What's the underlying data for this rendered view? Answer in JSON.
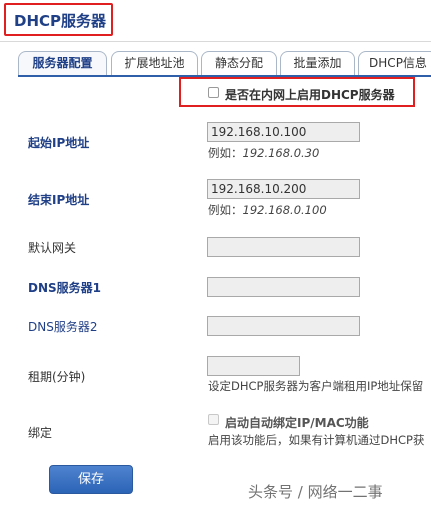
{
  "header": {
    "title": "DHCP服务器"
  },
  "tabs": [
    {
      "label": "服务器配置",
      "active": true
    },
    {
      "label": "扩展地址池"
    },
    {
      "label": "静态分配"
    },
    {
      "label": "批量添加"
    },
    {
      "label": "DHCP信息"
    }
  ],
  "enable": {
    "label": "是否在内网上启用DHCP服务器",
    "checked": false
  },
  "form": {
    "start_ip": {
      "label": "起始IP地址",
      "value": "192.168.10.100",
      "hint_prefix": "例如：",
      "hint_example": "192.168.0.30"
    },
    "end_ip": {
      "label": "结束IP地址",
      "value": "192.168.10.200",
      "hint_prefix": "例如：",
      "hint_example": "192.168.0.100"
    },
    "gateway": {
      "label": "默认网关",
      "value": ""
    },
    "dns1": {
      "label": "DNS服务器1",
      "value": ""
    },
    "dns2": {
      "label": "DNS服务器2",
      "value": ""
    },
    "lease": {
      "label": "租期(分钟)",
      "value": "",
      "desc": "设定DHCP服务器为客户端租用IP地址保留"
    },
    "bind": {
      "label": "绑定",
      "checkbox_label": "启动自动绑定IP/MAC功能",
      "desc": "启用该功能后，如果有计算机通过DHCP获"
    }
  },
  "actions": {
    "save_label": "保存"
  },
  "watermark": {
    "text": "头条号 / 网络一二事"
  }
}
